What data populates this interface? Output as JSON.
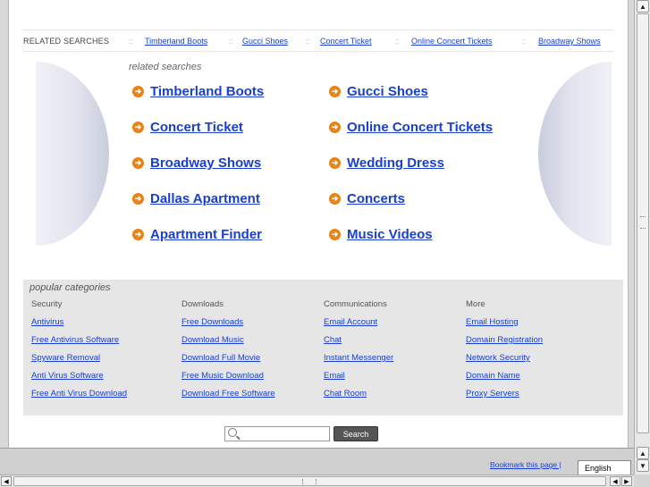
{
  "related_bar": {
    "label": "RELATED SEARCHES",
    "separator": "::",
    "links": [
      "Timberland Boots",
      "Gucci Shoes",
      "Concert Ticket",
      "Online Concert Tickets",
      "Broadway Shows"
    ]
  },
  "center": {
    "heading": "related searches",
    "arrow_glyph": "➔",
    "links": [
      "Timberland Boots",
      "Gucci Shoes",
      "Concert Ticket",
      "Online Concert Tickets",
      "Broadway Shows",
      "Wedding Dress",
      "Dallas Apartment",
      "Concerts",
      "Apartment Finder",
      "Music Videos"
    ]
  },
  "popular": {
    "title": "popular categories",
    "columns": [
      {
        "header": "Security",
        "links": [
          "Antivirus",
          "Free Antivirus Software",
          "Spyware Removal",
          "Anti Virus Software",
          "Free Anti Virus Download"
        ]
      },
      {
        "header": "Downloads",
        "links": [
          "Free Downloads",
          "Download Music",
          "Download Full Movie",
          "Free Music Download",
          "Download Free Software"
        ]
      },
      {
        "header": "Communications",
        "links": [
          "Email Account",
          "Chat",
          "Instant Messenger",
          "Email",
          "Chat Room"
        ]
      },
      {
        "header": "More",
        "links": [
          "Email Hosting",
          "Domain Registration",
          "Network Security",
          "Domain Name",
          "Proxy Servers"
        ]
      }
    ]
  },
  "search": {
    "button_label": "Search",
    "input_value": "",
    "icon": "search-icon"
  },
  "footer": {
    "bookmark_label": "Bookmark this page |",
    "language": "English"
  },
  "colors": {
    "link": "#1a3fcf",
    "arrow": "#e8831a",
    "panel": "#e6e6e6"
  }
}
